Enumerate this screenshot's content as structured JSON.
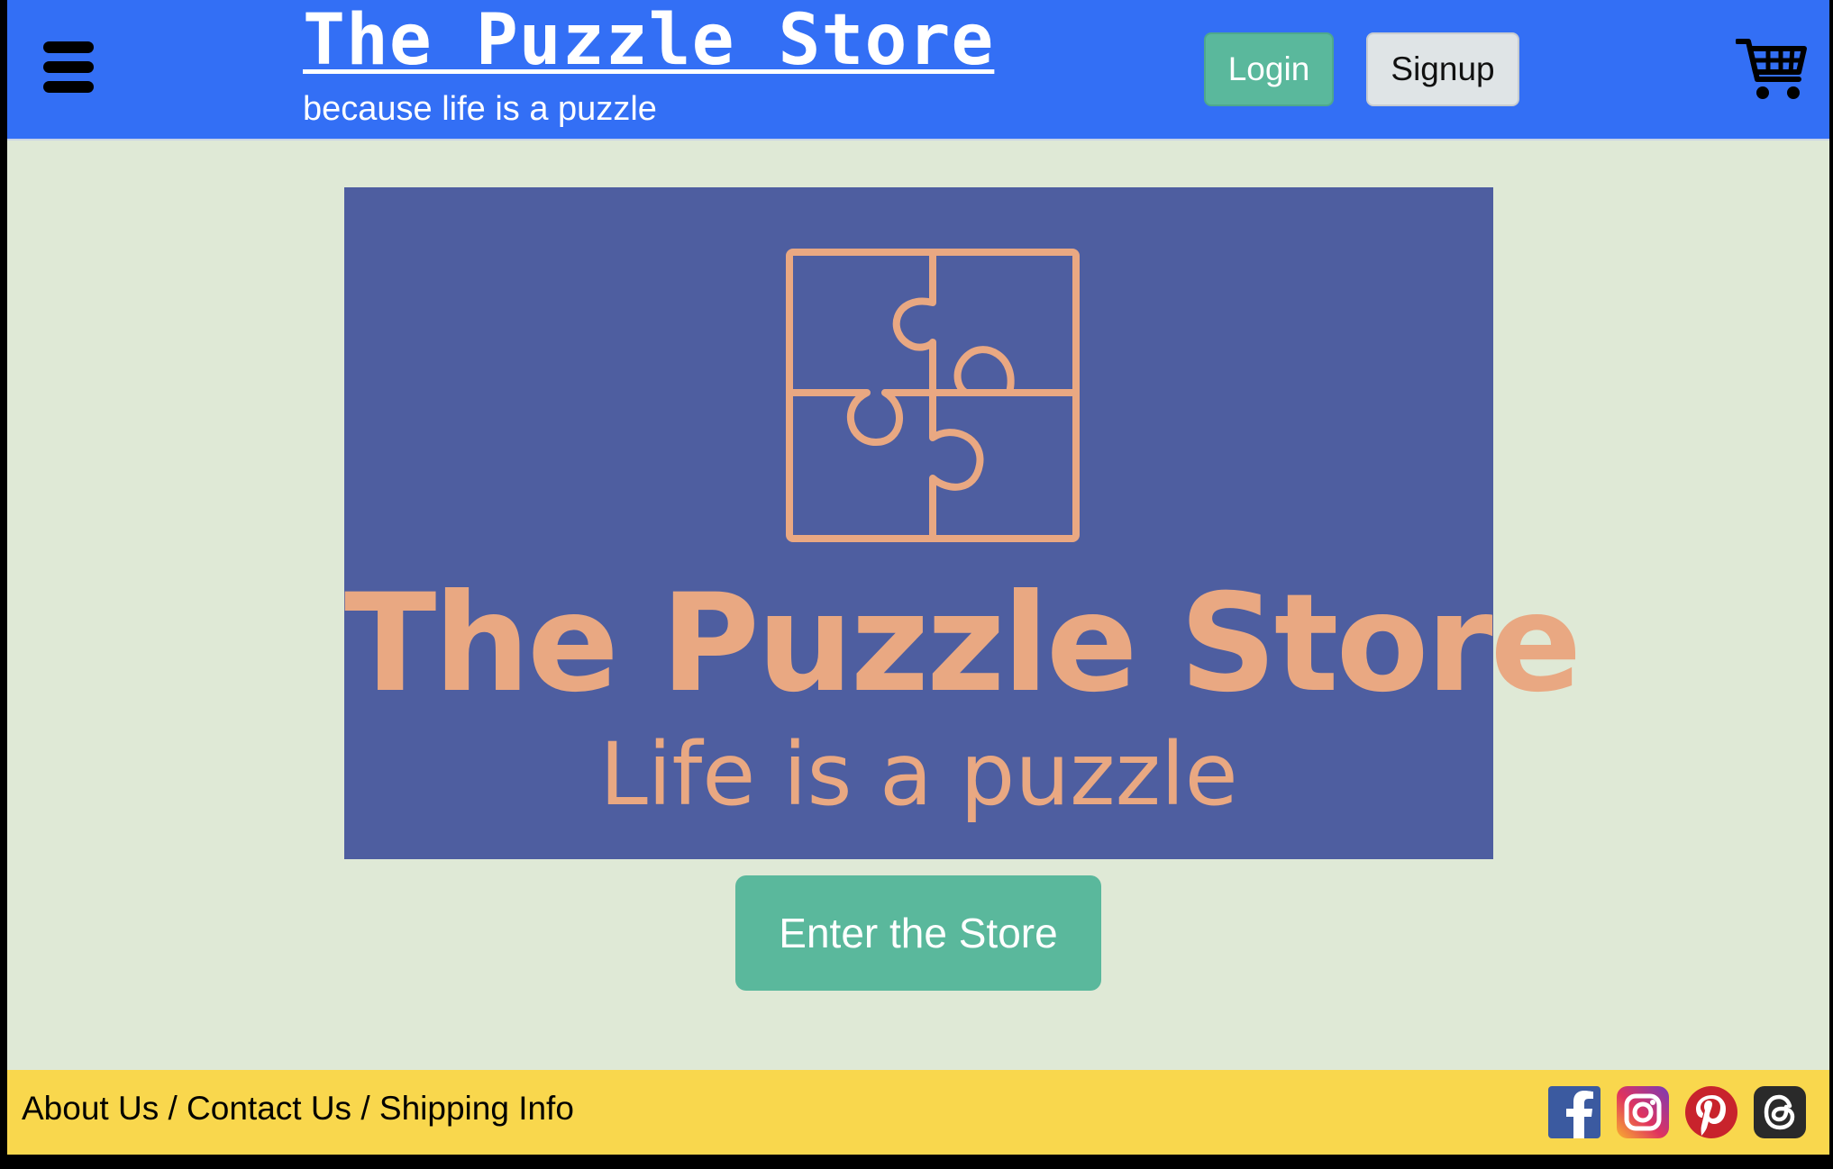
{
  "header": {
    "title": "The Puzzle Store",
    "tagline": "because life is a puzzle",
    "login_label": "Login",
    "signup_label": "Signup"
  },
  "hero": {
    "title": "The Puzzle Store",
    "subtitle": "Life is a puzzle",
    "enter_label": "Enter the Store"
  },
  "footer": {
    "links": [
      "About Us",
      "Contact Us",
      "Shipping Info"
    ],
    "separator": " / ",
    "social": [
      "facebook-icon",
      "instagram-icon",
      "pinterest-icon",
      "threads-icon"
    ]
  },
  "colors": {
    "header_bg": "#336ff5",
    "page_bg": "#dfe9d6",
    "accent_green": "#5ab89c",
    "hero_bg": "#4e5ea0",
    "hero_text": "#e9a882",
    "footer_bg": "#f9d74d"
  }
}
